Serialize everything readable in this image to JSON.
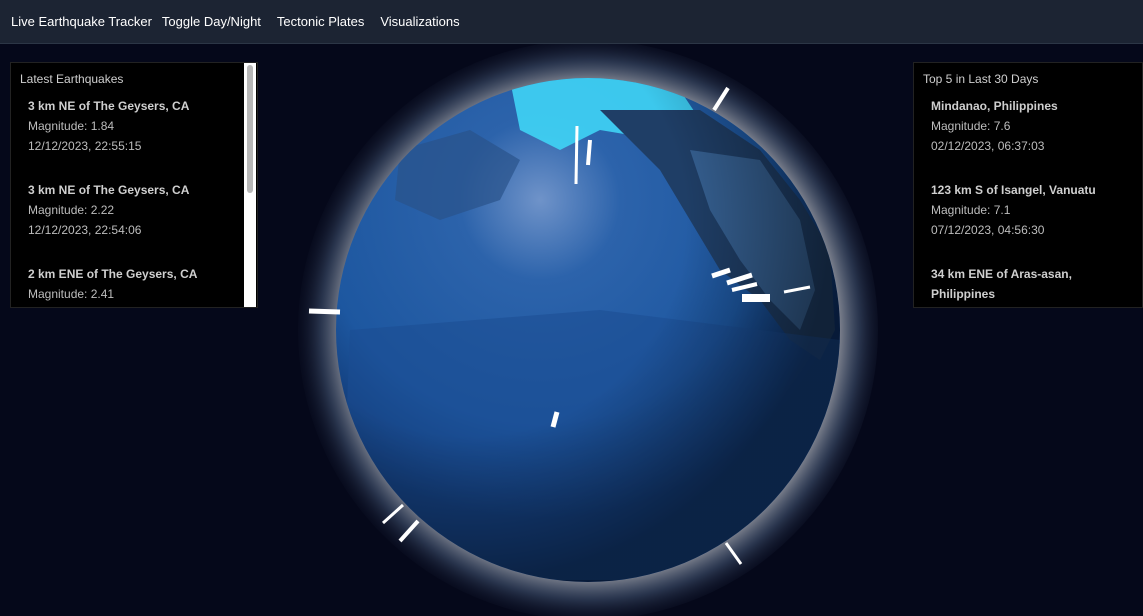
{
  "nav": {
    "items": [
      "Live Earthquake Tracker",
      "Toggle Day/Night",
      "Tectonic Plates",
      "Visualizations"
    ]
  },
  "latest_panel": {
    "title": "Latest Earthquakes",
    "quakes": [
      {
        "place": "3 km NE of The Geysers, CA",
        "magnitude": "Magnitude: 1.84",
        "time": "12/12/2023, 22:55:15"
      },
      {
        "place": "3 km NE of The Geysers, CA",
        "magnitude": "Magnitude: 2.22",
        "time": "12/12/2023, 22:54:06"
      },
      {
        "place": "2 km ENE of The Geysers, CA",
        "magnitude": "Magnitude: 2.41",
        "time": ""
      }
    ]
  },
  "top_panel": {
    "title": "Top 5 in Last 30 Days",
    "quakes": [
      {
        "place": "Mindanao, Philippines",
        "magnitude": "Magnitude: 7.6",
        "time": "02/12/2023, 06:37:03"
      },
      {
        "place": "123 km S of Isangel, Vanuatu",
        "magnitude": "Magnitude: 7.1",
        "time": "07/12/2023, 04:56:30"
      },
      {
        "place": "34 km ENE of Aras-asan,",
        "place2": "Philippines",
        "magnitude": "",
        "time": ""
      }
    ]
  },
  "colors": {
    "background": "#05081a",
    "topbar": "#1c2433",
    "ocean": "#1d5fa8",
    "ice": "#3fd4f5",
    "marker": "#ffffff"
  },
  "globe": {
    "icon": "earth-globe",
    "marker_count": 13
  }
}
